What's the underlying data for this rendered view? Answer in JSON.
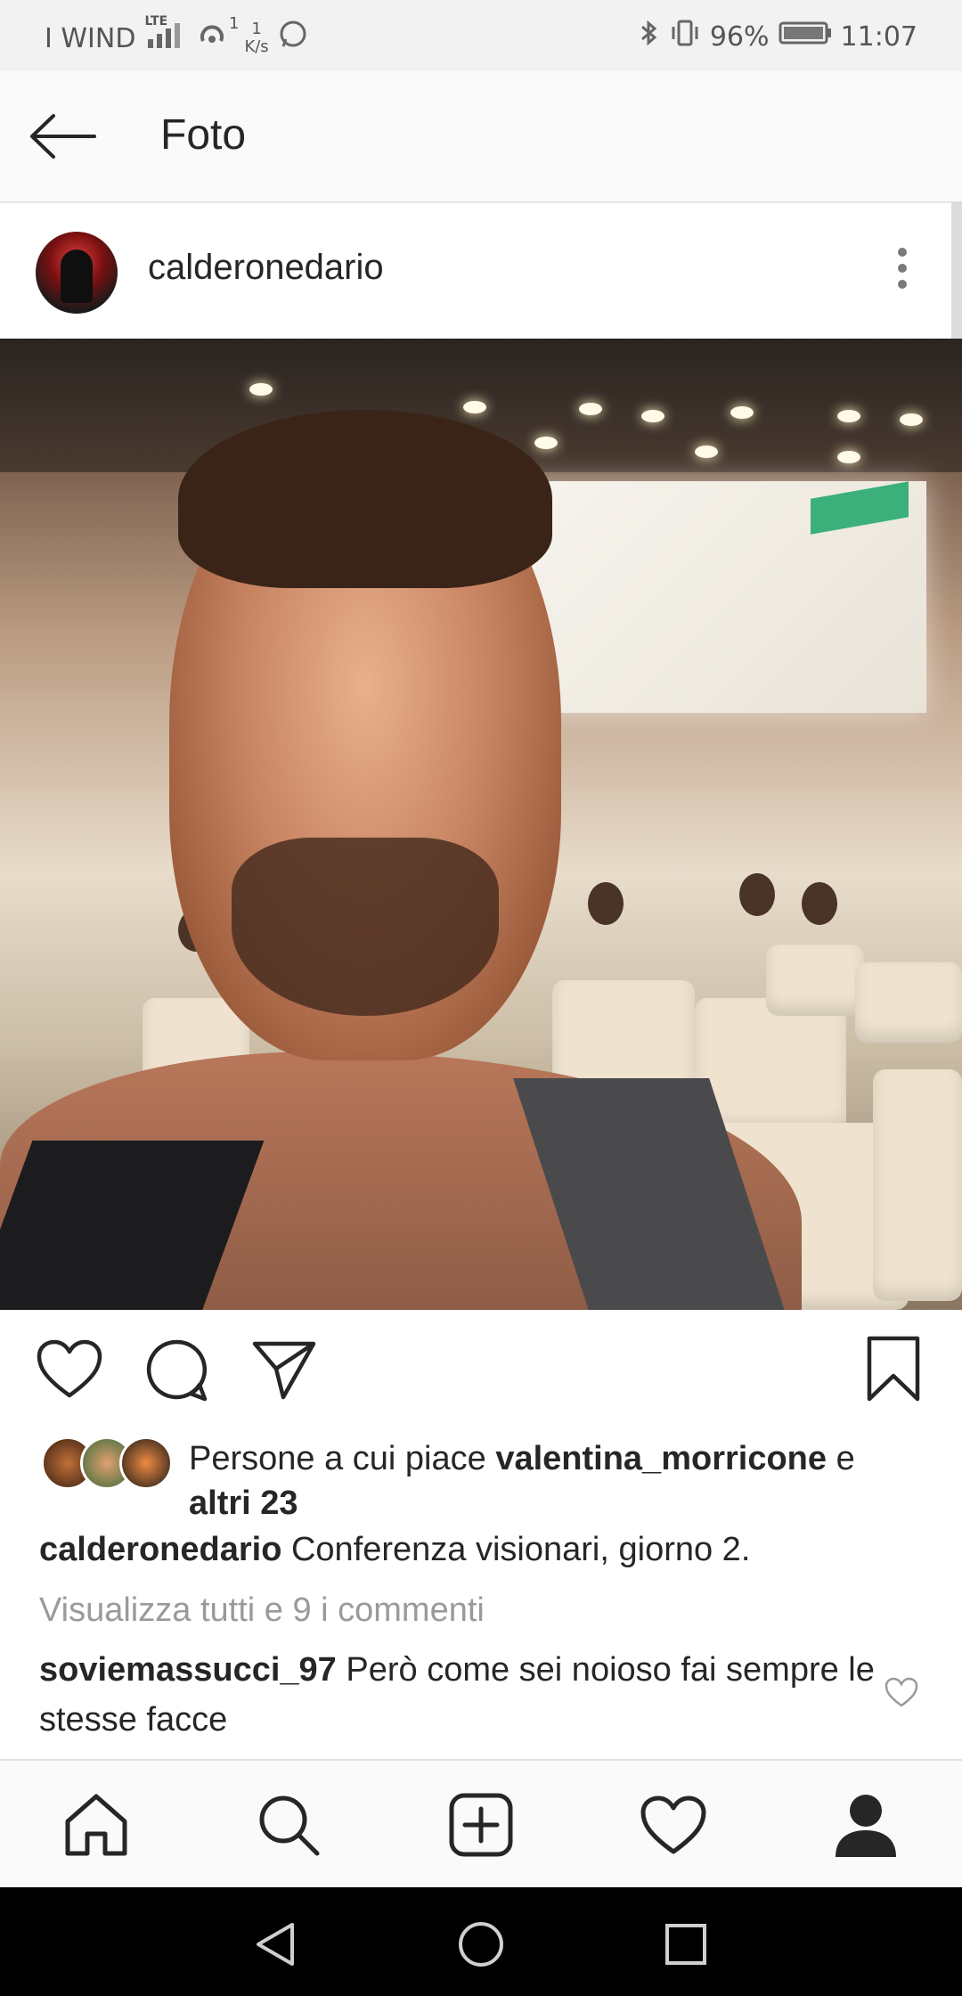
{
  "status_bar": {
    "carrier": "I WIND",
    "network": "LTE",
    "hotspot_count": "1",
    "speed_value": "1",
    "speed_unit": "K/s",
    "battery": "96%",
    "time": "11:07",
    "icons": [
      "signal-icon",
      "hotspot-icon",
      "whatsapp-icon",
      "bluetooth-icon",
      "vibrate-icon",
      "battery-icon"
    ]
  },
  "app_bar": {
    "title": "Foto",
    "back_icon": "arrow-left-icon"
  },
  "post": {
    "username": "calderonedario",
    "more_icon": "more-vertical-icon",
    "image_alt": "selfie in conference hall",
    "actions": [
      "heart-icon",
      "comment-icon",
      "share-icon",
      "bookmark-icon"
    ],
    "likes_prefix": "Persone a cui piace ",
    "likes_user": "valentina_morricone",
    "likes_mid": " e ",
    "likes_others": "altri 23",
    "caption_user": "calderonedario",
    "caption_text": " Conferenza visionari,  giorno 2.",
    "view_comments": "Visualizza tutti e 9 i commenti",
    "comment_user": "soviemassucci_97",
    "comment_text": " Però come sei noioso fai sempre le stesse facce"
  },
  "bottom_nav": {
    "items": [
      "home-icon",
      "search-icon",
      "add-post-icon",
      "activity-heart-icon",
      "profile-icon"
    ]
  },
  "system_nav": {
    "items": [
      "back-triangle-icon",
      "home-circle-icon",
      "recents-square-icon"
    ]
  }
}
